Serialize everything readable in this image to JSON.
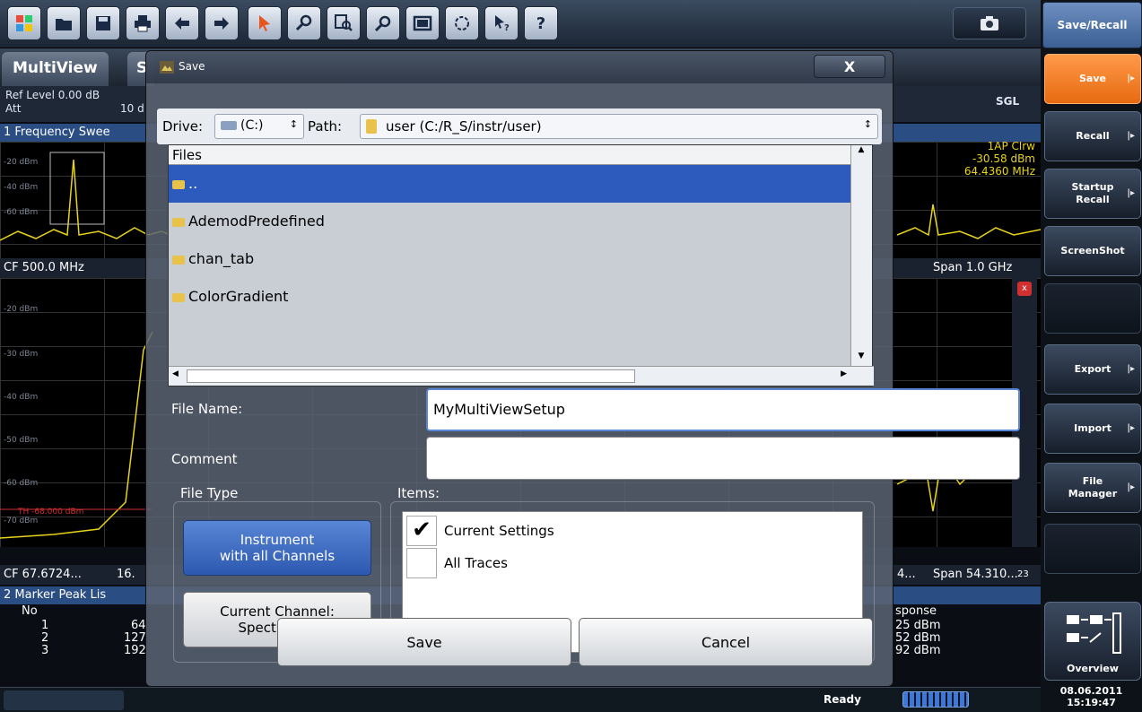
{
  "toolbar": {
    "buttons": [
      "windows-logo-icon",
      "open-file-icon",
      "save-file-icon",
      "print-icon",
      "undo-icon",
      "redo-icon",
      "pointer-icon",
      "zoom-icon",
      "multiple-zoom-icon",
      "zoom-off-icon",
      "full-screen-icon",
      "sequencer-icon",
      "context-help-icon",
      "help-icon"
    ],
    "help_label": "?"
  },
  "softkeys": {
    "title": "Save/Recall",
    "items": [
      {
        "label": "Save",
        "active": true,
        "arrow": true
      },
      {
        "label": "Recall",
        "arrow": true
      },
      {
        "label": "Startup\nRecall",
        "arrow": true
      },
      {
        "label": "ScreenShot",
        "arrow": false
      },
      {
        "label": "",
        "empty": true
      },
      {
        "label": "Export",
        "arrow": true
      },
      {
        "label": "Import",
        "arrow": true
      },
      {
        "label": "File\nManager",
        "arrow": true
      },
      {
        "label": "",
        "empty": true
      }
    ],
    "overview_label": "Overview",
    "date": "08.06.2011",
    "time": "15:19:47"
  },
  "background": {
    "tabs": [
      "MultiView",
      "S"
    ],
    "ref_level": "Ref Level 0.00 dB",
    "att": "Att",
    "att_val": "10 d",
    "diag1_title": "1 Frequency Swee",
    "diag1_right": "SGL",
    "trace_info": "1AP Clrw",
    "marker_level": "-30.58 dBm",
    "marker_freq": "64.4360 MHz",
    "cf1": "CF 500.0 MHz",
    "span1": "Span 1.0 GHz",
    "cf2": "CF 67.6724...",
    "cf2b": "16.",
    "span2": "Span 54.310...",
    "span2_prefix": "4...",
    "peak_title": "2 Marker Peak Lis",
    "peak_no": "No",
    "peak_rows": [
      "1",
      "2",
      "3"
    ],
    "peak_vals": [
      "64",
      "127",
      "192"
    ],
    "response_hdr": "sponse",
    "response": [
      "25 dBm",
      "52 dBm",
      "92 dBm"
    ],
    "axis1": [
      "-20 dBm",
      "-40 dBm",
      "-60 dBm"
    ],
    "axis2": [
      "-20 dBm",
      "-30 dBm",
      "-40 dBm",
      "-50 dBm",
      "-60 dBm",
      "-70 dBm"
    ],
    "th_label": "TH -68.000 dBm",
    "right_num": "23"
  },
  "status": {
    "ready": "Ready"
  },
  "dialog": {
    "title": "Save",
    "close": "X",
    "drive_label": "Drive:",
    "drive_value": "(C:)",
    "path_label": "Path:",
    "path_value": "user (C:/R_S/instr/user)",
    "files_header": "Files",
    "files": [
      {
        "name": "..",
        "selected": true
      },
      {
        "name": "AdemodPredefined"
      },
      {
        "name": "chan_tab"
      },
      {
        "name": "ColorGradient"
      }
    ],
    "file_name_label": "File Name:",
    "file_name_value": "MyMultiViewSetup",
    "comment_label": "Comment",
    "comment_value": "",
    "file_type_label": "File Type",
    "items_label": "Items:",
    "type_instrument": "Instrument\nwith all Channels",
    "type_channel": "Current Channel:\nSpectrum 2",
    "items": [
      {
        "label": "Current Settings",
        "checked": true
      },
      {
        "label": "All Traces",
        "checked": false
      }
    ],
    "save_button": "Save",
    "cancel_button": "Cancel"
  }
}
